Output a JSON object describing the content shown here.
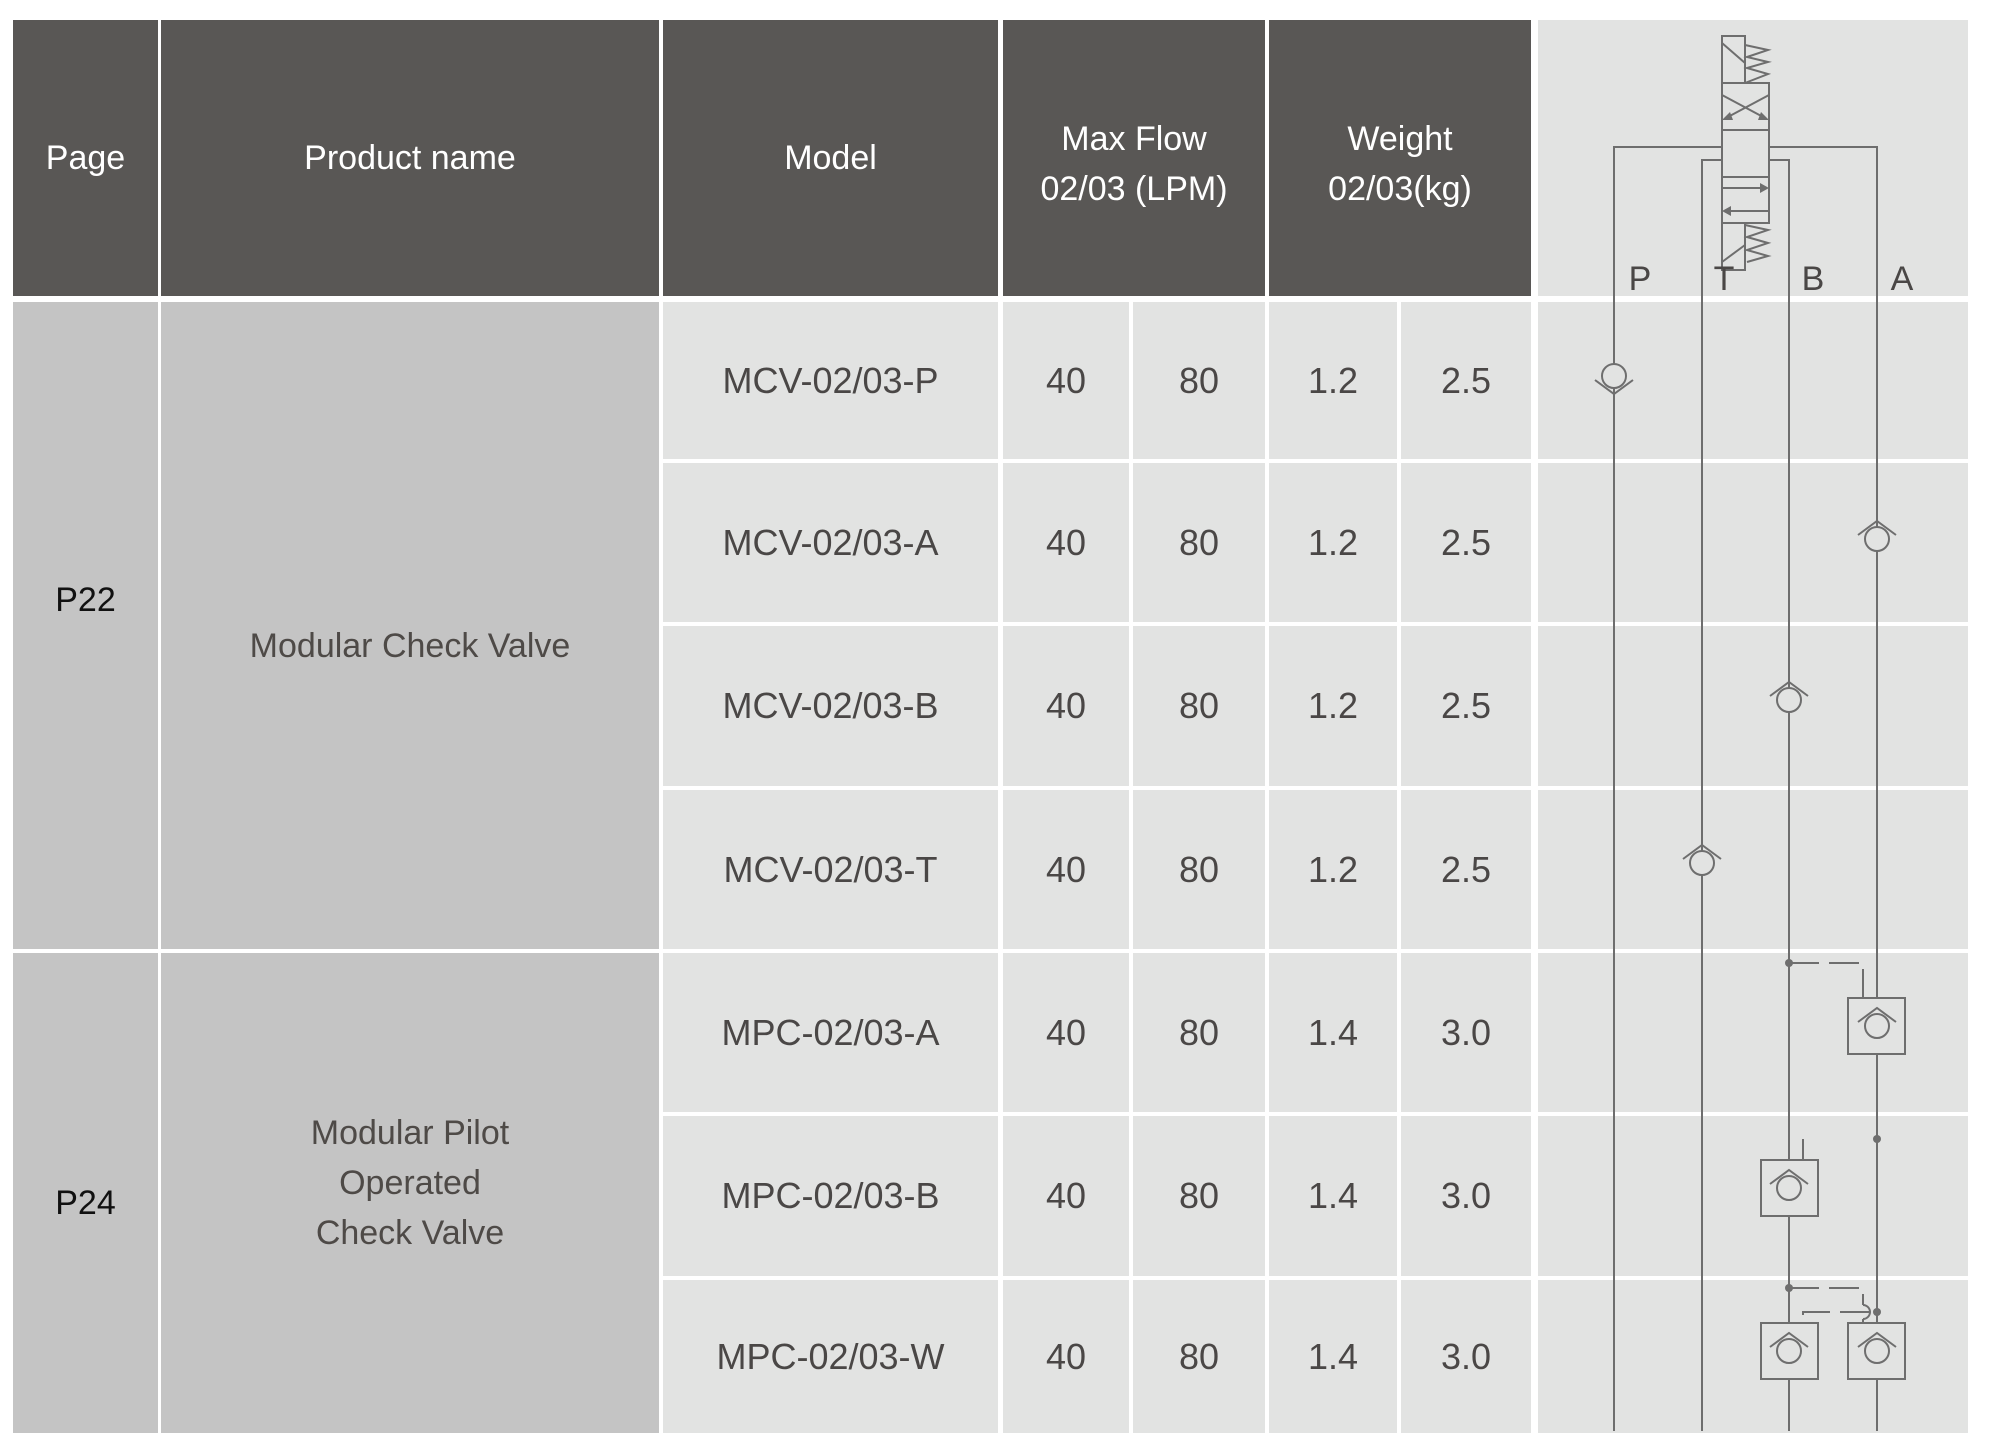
{
  "header": {
    "page": "Page",
    "product_name": "Product name",
    "model": "Model",
    "max_flow": [
      "Max Flow",
      "02/03 (LPM)"
    ],
    "weight": [
      "Weight",
      "02/03(kg)"
    ],
    "ports": [
      "P",
      "T",
      "B",
      "A"
    ]
  },
  "groups": [
    {
      "page": "P22",
      "product_name": [
        "Modular Check Valve"
      ]
    },
    {
      "page": "P24",
      "product_name": [
        "Modular Pilot",
        "Operated",
        "Check Valve"
      ]
    }
  ],
  "rows": [
    {
      "model": "MCV-02/03-P",
      "flow_02": "40",
      "flow_03": "80",
      "weight_02": "1.2",
      "weight_03": "2.5",
      "symbol": "check-valve-P"
    },
    {
      "model": "MCV-02/03-A",
      "flow_02": "40",
      "flow_03": "80",
      "weight_02": "1.2",
      "weight_03": "2.5",
      "symbol": "check-valve-A"
    },
    {
      "model": "MCV-02/03-B",
      "flow_02": "40",
      "flow_03": "80",
      "weight_02": "1.2",
      "weight_03": "2.5",
      "symbol": "check-valve-B"
    },
    {
      "model": "MCV-02/03-T",
      "flow_02": "40",
      "flow_03": "80",
      "weight_02": "1.2",
      "weight_03": "2.5",
      "symbol": "check-valve-T"
    },
    {
      "model": "MPC-02/03-A",
      "flow_02": "40",
      "flow_03": "80",
      "weight_02": "1.4",
      "weight_03": "3.0",
      "symbol": "pilot-check-A"
    },
    {
      "model": "MPC-02/03-B",
      "flow_02": "40",
      "flow_03": "80",
      "weight_02": "1.4",
      "weight_03": "3.0",
      "symbol": "pilot-check-B"
    },
    {
      "model": "MPC-02/03-W",
      "flow_02": "40",
      "flow_03": "80",
      "weight_02": "1.4",
      "weight_03": "3.0",
      "symbol": "pilot-check-W"
    }
  ],
  "colors": {
    "header_bg": "#595755",
    "group_bg": "#c4c4c4",
    "body_bg": "#e2e3e2",
    "line": "#6e6e6e"
  }
}
